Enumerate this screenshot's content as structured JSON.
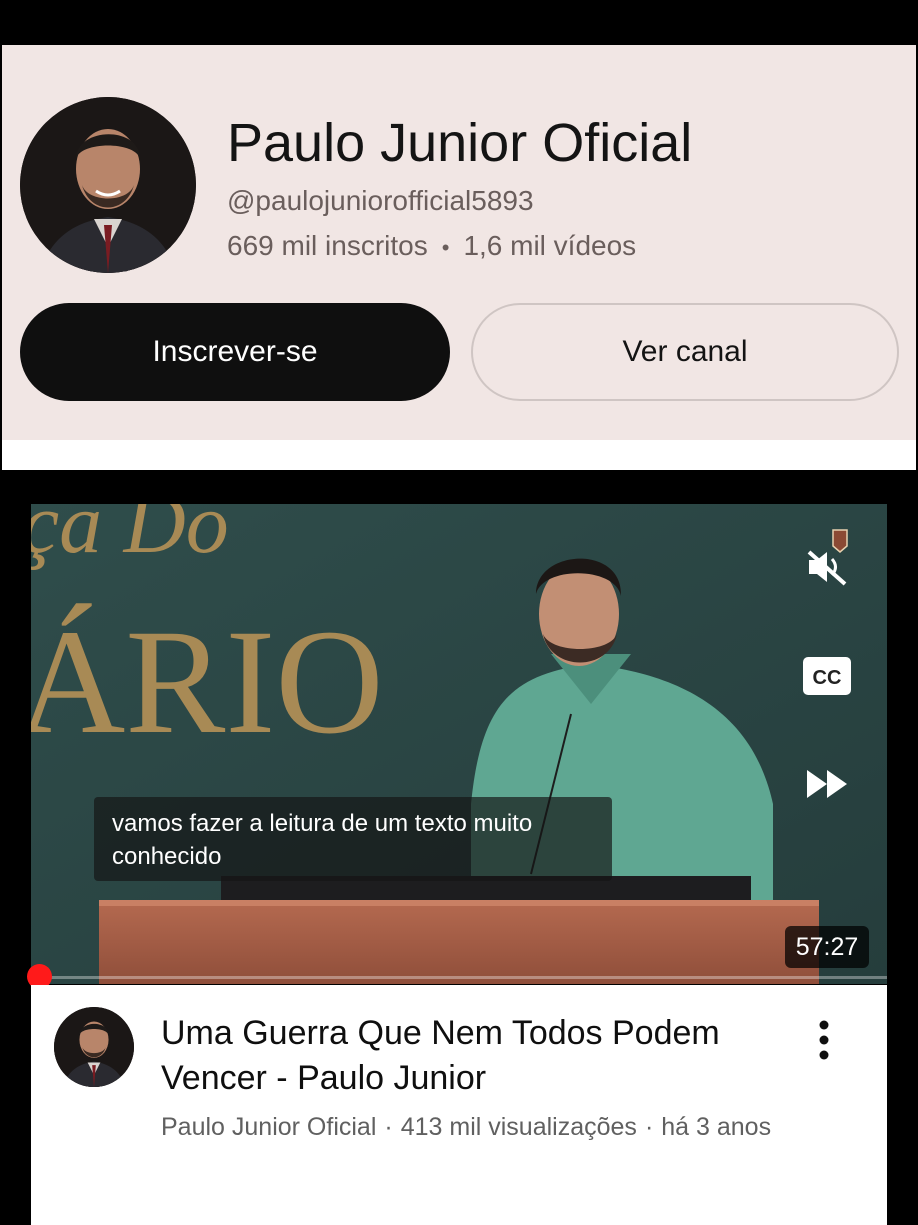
{
  "channel": {
    "name": "Paulo Junior Oficial",
    "handle": "@paulojuniorofficial5893",
    "subscribers": "669 mil inscritos",
    "separator": "•",
    "videos": "1,6 mil vídeos",
    "subscribe_label": "Inscrever-se",
    "view_channel_label": "Ver canal"
  },
  "video": {
    "background_text_1": "ça Do",
    "background_text_2": "ÁRIO",
    "caption_line_1": "vamos fazer a leitura de um texto muito",
    "caption_line_2": "conhecido",
    "duration": "57:27",
    "cc_label": "CC",
    "progress_fraction": 0.01,
    "title": "Uma Guerra Que Nem Todos Podem Vencer - Paulo Junior",
    "channel": "Paulo Junior Oficial",
    "meta_separator": "·",
    "views": "413 mil visualizações",
    "age": "há 3 anos"
  },
  "icons": {
    "mute": "muted-speaker-icon",
    "captions": "closed-captions-icon",
    "forward": "fast-forward-icon",
    "more": "more-vertical-icon"
  },
  "colors": {
    "card_background": "#f1e6e4",
    "subscribe_button": "#0f0f0f",
    "progress": "#ff1a1a"
  }
}
